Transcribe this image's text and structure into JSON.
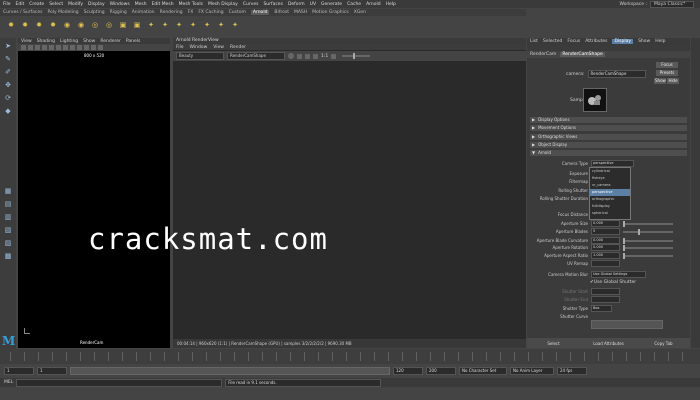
{
  "menubar": {
    "items": [
      "File",
      "Edit",
      "Create",
      "Select",
      "Modify",
      "Display",
      "Windows",
      "Mesh",
      "Edit Mesh",
      "Mesh Tools",
      "Mesh Display",
      "Curves",
      "Surfaces",
      "Deform",
      "UV",
      "Generate",
      "Cache",
      "Arnold",
      "Help"
    ]
  },
  "workspace": {
    "label": "Workspace :",
    "value": "Maya Classic*"
  },
  "shelf_tabs": [
    "Curves / Surfaces",
    "Poly Modeling",
    "Sculpting",
    "Rigging",
    "Animation",
    "Rendering",
    "FX",
    "FX Caching",
    "Custom",
    "Arnold",
    "Bifrost",
    "MASH",
    "Motion Graphics",
    "XGen"
  ],
  "shelf_active_tab": "Arnold",
  "viewport": {
    "menu": [
      "View",
      "Shading",
      "Lighting",
      "Show",
      "Renderer",
      "Panels"
    ],
    "resolution": "800 x 520",
    "camera": "RenderCam"
  },
  "renderview": {
    "title": "Arnold RenderView",
    "menu": [
      "File",
      "Window",
      "View",
      "Render"
    ],
    "mode": "Beauty",
    "camera": "RenderCamShape",
    "zoom": "1:1",
    "status": "00:04:14 | 960x620 (1:1) | RenderCamShape (GPU) | samples 3/2/2/2/2/2 | 9690.30 MB"
  },
  "attr_editor": {
    "tabs": [
      "List",
      "Selected",
      "Focus",
      "Attributes",
      "Display",
      "Show",
      "Help"
    ],
    "active_tab": "Display",
    "node_tabs": [
      "RenderCam",
      "RenderCamShape"
    ],
    "active_node_tab": "RenderCamShape",
    "camera_label": "camera:",
    "camera_value": "RenderCamShape",
    "focus_btn": "Focus",
    "presets_btn": "Presets",
    "show_btn": "Show",
    "hide_btn": "Hide",
    "sample_label": "Sample",
    "sections": [
      "Display Options",
      "Movement Options",
      "Orthographic Views",
      "Object Display",
      "Arnold"
    ],
    "camera_type_label": "Camera Type",
    "camera_type_value": "perspective",
    "attrs": [
      {
        "label": "Exposure",
        "value": ""
      },
      {
        "label": "Filtermap",
        "value": ""
      },
      {
        "label": "Rolling Shutter",
        "value": ""
      },
      {
        "label": "Rolling Shutter Duration",
        "value": ""
      },
      {
        "label": "Focus Distance",
        "value": ""
      },
      {
        "label": "Aperture Size",
        "value": "0.000"
      },
      {
        "label": "Aperture Blades",
        "value": "5"
      },
      {
        "label": "Aperture Blade Curvature",
        "value": "0.000"
      },
      {
        "label": "Aperture Rotation",
        "value": "0.000"
      },
      {
        "label": "Aperture Aspect Ratio",
        "value": "1.000"
      },
      {
        "label": "UV Remap",
        "value": ""
      }
    ],
    "camera_type_options": [
      "cylindrical",
      "fisheye",
      "vr_camera",
      "perspective",
      "orthographic",
      "fulldisplay",
      "spherical"
    ],
    "camera_motion_blur_label": "Camera Motion Blur",
    "camera_motion_blur_value": "Use Global Settings",
    "use_global_shutter": "Use Global Shutter",
    "shutter_start": "Shutter Start",
    "shutter_end": "Shutter End",
    "shutter_type_label": "Shutter Type",
    "shutter_type_value": "Box",
    "shutter_curve": "Shutter Curve",
    "select_btn": "Select",
    "load_btn": "Load Attributes",
    "copy_btn": "Copy Tab"
  },
  "range": {
    "start": "1",
    "end": "120",
    "anim_end": "200",
    "char_set": "No Character Set",
    "anim_layer": "No Anim Layer",
    "fps": "24 fps"
  },
  "cmd": {
    "label": "MEL",
    "status": "File read in  9.1 seconds."
  },
  "chart_colors": {
    "accent": "#5b7fa5",
    "shelf_icon": "#e0c050",
    "logo": "#35a0d8"
  },
  "watermark": "cracksmat.com"
}
